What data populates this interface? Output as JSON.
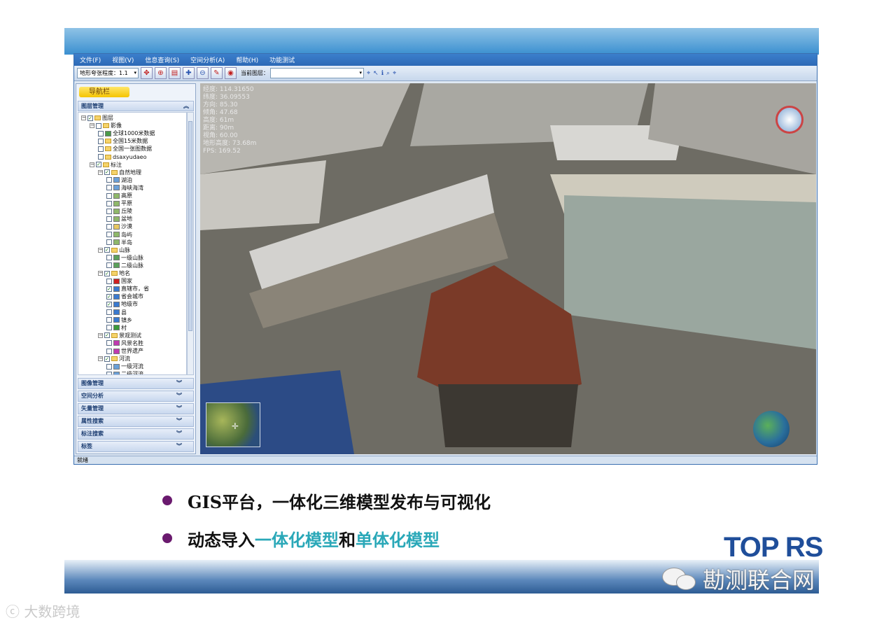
{
  "app": {
    "menu": [
      "文件(F)",
      "视图(V)",
      "信息查询(S)",
      "空间分析(A)",
      "帮助(H)",
      "功能测试"
    ],
    "toolbar": {
      "terrain_select": "地形夸张程度：1.1",
      "current_layer_label": "当前图层：",
      "current_layer_value": ""
    },
    "nav": {
      "title": "导航栏",
      "layer_manager": "图层管理"
    },
    "tree": [
      {
        "indent": 0,
        "exp": "−",
        "cb": "✓",
        "kind": "folder",
        "label": "图层"
      },
      {
        "indent": 1,
        "exp": "−",
        "cb": "",
        "kind": "folder",
        "label": "影像"
      },
      {
        "indent": 2,
        "exp": "",
        "cb": "",
        "kind": "globe",
        "label": "全球1000米数据"
      },
      {
        "indent": 2,
        "exp": "",
        "cb": "",
        "kind": "folder",
        "label": "全国15米数据"
      },
      {
        "indent": 2,
        "exp": "",
        "cb": "",
        "kind": "folder",
        "label": "全国一张图数据"
      },
      {
        "indent": 2,
        "exp": "",
        "cb": "",
        "kind": "folder",
        "label": "dsaxyudaeo"
      },
      {
        "indent": 1,
        "exp": "−",
        "cb": "✓",
        "kind": "folder",
        "label": "标注"
      },
      {
        "indent": 2,
        "exp": "−",
        "cb": "✓",
        "kind": "folder",
        "label": "自然地理"
      },
      {
        "indent": 3,
        "exp": "",
        "cb": "",
        "kind": "water",
        "label": "湖泊"
      },
      {
        "indent": 3,
        "exp": "",
        "cb": "",
        "kind": "water",
        "label": "海峡海湾"
      },
      {
        "indent": 3,
        "exp": "",
        "cb": "",
        "kind": "land",
        "label": "高原"
      },
      {
        "indent": 3,
        "exp": "",
        "cb": "",
        "kind": "land",
        "label": "平原"
      },
      {
        "indent": 3,
        "exp": "",
        "cb": "",
        "kind": "land",
        "label": "丘陵"
      },
      {
        "indent": 3,
        "exp": "",
        "cb": "",
        "kind": "land",
        "label": "盆地"
      },
      {
        "indent": 3,
        "exp": "",
        "cb": "",
        "kind": "sand",
        "label": "沙漠"
      },
      {
        "indent": 3,
        "exp": "",
        "cb": "",
        "kind": "land",
        "label": "岛屿"
      },
      {
        "indent": 3,
        "exp": "",
        "cb": "",
        "kind": "land",
        "label": "半岛"
      },
      {
        "indent": 2,
        "exp": "−",
        "cb": "✓",
        "kind": "folder",
        "label": "山脉"
      },
      {
        "indent": 3,
        "exp": "",
        "cb": "",
        "kind": "mount",
        "label": "一级山脉"
      },
      {
        "indent": 3,
        "exp": "",
        "cb": "",
        "kind": "mount",
        "label": "二级山脉"
      },
      {
        "indent": 2,
        "exp": "−",
        "cb": "✓",
        "kind": "folder",
        "label": "地名"
      },
      {
        "indent": 3,
        "exp": "",
        "cb": "",
        "kind": "flag",
        "label": "国家"
      },
      {
        "indent": 3,
        "exp": "",
        "cb": "✓",
        "kind": "city",
        "label": "直辖市，省"
      },
      {
        "indent": 3,
        "exp": "",
        "cb": "✓",
        "kind": "city",
        "label": "省会城市"
      },
      {
        "indent": 3,
        "exp": "",
        "cb": "✓",
        "kind": "city",
        "label": "地级市"
      },
      {
        "indent": 3,
        "exp": "",
        "cb": "",
        "kind": "city",
        "label": "县"
      },
      {
        "indent": 3,
        "exp": "",
        "cb": "",
        "kind": "city",
        "label": "镇乡"
      },
      {
        "indent": 3,
        "exp": "",
        "cb": "",
        "kind": "tree",
        "label": "村"
      },
      {
        "indent": 2,
        "exp": "−",
        "cb": "✓",
        "kind": "folder",
        "label": "景观测试"
      },
      {
        "indent": 3,
        "exp": "",
        "cb": "",
        "kind": "scenic",
        "label": "风景名胜"
      },
      {
        "indent": 3,
        "exp": "",
        "cb": "",
        "kind": "scenic",
        "label": "世界遗产"
      },
      {
        "indent": 2,
        "exp": "−",
        "cb": "✓",
        "kind": "folder",
        "label": "河流"
      },
      {
        "indent": 3,
        "exp": "",
        "cb": "",
        "kind": "water",
        "label": "一级河流"
      },
      {
        "indent": 3,
        "exp": "",
        "cb": "",
        "kind": "water",
        "label": "二级河流"
      }
    ],
    "accordion": [
      "图像管理",
      "空间分析",
      "矢量管理",
      "属性搜索",
      "标注搜索",
      "标签"
    ],
    "overlay": [
      "经度: 114.31650",
      "纬度: 36.09553",
      "方向: 85.30",
      "倾角: 47.68",
      "高度: 61m",
      "距离: 90m",
      "视角: 60.00",
      "地形高度: 73.68m",
      "FPS: 169.52"
    ],
    "status": "就绪"
  },
  "slide": {
    "bullet1": "GIS平台，一体化三维模型发布与可视化",
    "bullet2_a": "动态导入",
    "bullet2_b": "一体化模型",
    "bullet2_c": "和",
    "bullet2_d": "单体化模型",
    "logo": "TOP RS",
    "watermark_right": "勘测联合网",
    "watermark_left": "大数跨境"
  },
  "colors": {
    "accent": "#2aa8b8",
    "bullet": "#6a1a6e",
    "logo": "#1f4e9a"
  }
}
